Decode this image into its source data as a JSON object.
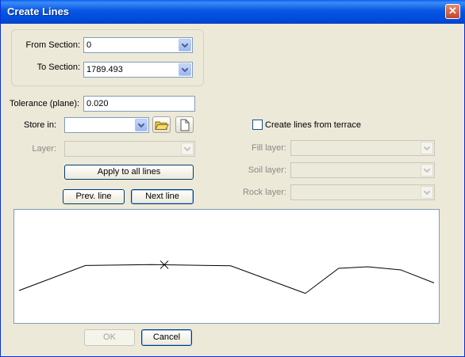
{
  "window": {
    "title": "Create Lines",
    "close_glyph": "✕"
  },
  "from_section": {
    "label": "From Section:",
    "value": "0"
  },
  "to_section": {
    "label": "To Section:",
    "value": "1789.493"
  },
  "tolerance": {
    "label": "Tolerance (plane):",
    "value": "0.020"
  },
  "store_in": {
    "label": "Store in:",
    "value": "",
    "open_icon": "folder-open-icon",
    "new_icon": "new-file-icon"
  },
  "layer": {
    "label": "Layer:",
    "value": ""
  },
  "apply_all_label": "Apply to all lines",
  "prev_line_label": "Prev. line",
  "next_line_label": "Next line",
  "terrace": {
    "checkbox_label": "Create lines from terrace",
    "checked": false
  },
  "fill_layer": {
    "label": "Fill layer:",
    "value": ""
  },
  "soil_layer": {
    "label": "Soil layer:",
    "value": ""
  },
  "rock_layer": {
    "label": "Rock layer:",
    "value": ""
  },
  "ok_label": "OK",
  "cancel_label": "Cancel",
  "profile": {
    "points": [
      [
        0,
        1.1
      ],
      [
        0.16,
        0.31
      ],
      [
        0.32,
        0.28
      ],
      [
        0.51,
        0.32
      ],
      [
        0.69,
        1.19
      ],
      [
        0.77,
        0.4
      ],
      [
        0.84,
        0.35
      ],
      [
        0.92,
        0.45
      ],
      [
        1.0,
        0.86
      ]
    ],
    "marker_x": 0.35
  }
}
